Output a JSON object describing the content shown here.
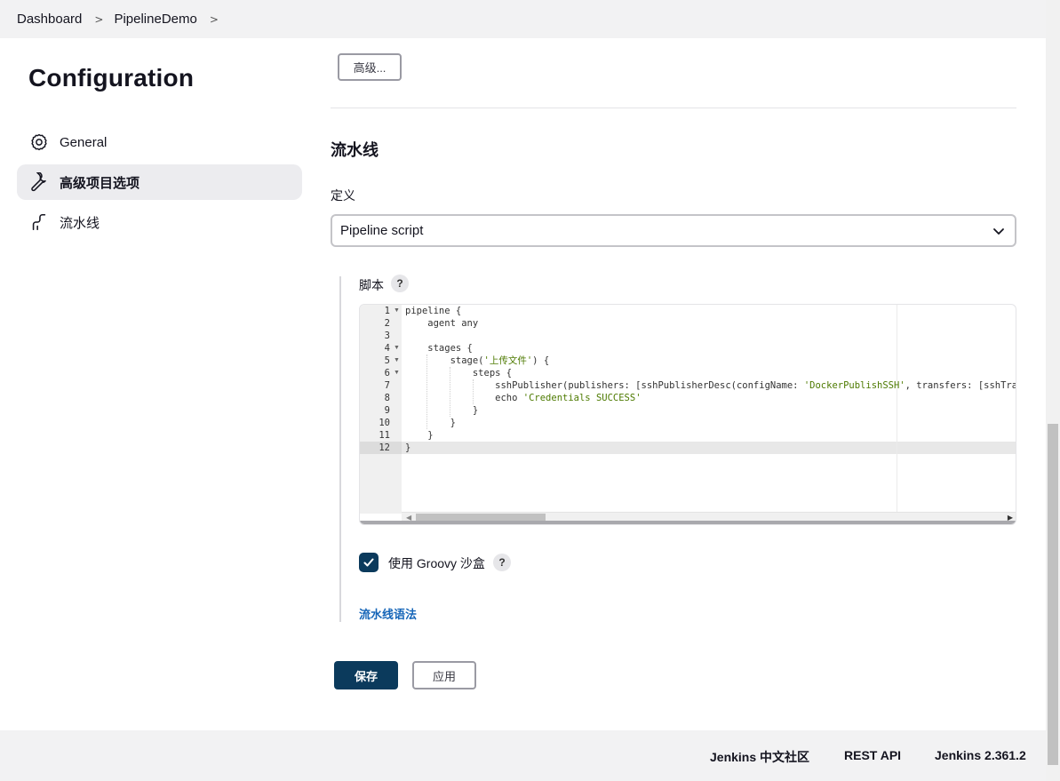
{
  "breadcrumb": {
    "items": [
      "Dashboard",
      "PipelineDemo"
    ],
    "separator": ">"
  },
  "sidebar": {
    "title": "Configuration",
    "items": [
      {
        "label": "General",
        "icon": "gear-icon"
      },
      {
        "label": "高级项目选项",
        "icon": "wrench-icon",
        "active": true
      },
      {
        "label": "流水线",
        "icon": "pipeline-icon"
      }
    ]
  },
  "main": {
    "advanced_button": "高级...",
    "section_title": "流水线",
    "definition_label": "定义",
    "definition_value": "Pipeline script",
    "script_label": "脚本",
    "help_label": "?",
    "code_lines": [
      {
        "num": "1",
        "text": "pipeline {"
      },
      {
        "num": "2",
        "text": "    agent any"
      },
      {
        "num": "3",
        "text": ""
      },
      {
        "num": "4",
        "text": "    stages {"
      },
      {
        "num": "5",
        "pre": "        stage(",
        "str": "'上传文件'",
        "post": ") {"
      },
      {
        "num": "6",
        "text": "            steps {"
      },
      {
        "num": "7",
        "pre": "                sshPublisher(publishers: [sshPublisherDesc(configName: ",
        "str": "'DockerPublishSSH'",
        "post": ", transfers: [sshTra"
      },
      {
        "num": "8",
        "pre": "                echo ",
        "str": "'Credentials SUCCESS'",
        "post": ""
      },
      {
        "num": "9",
        "text": "            }"
      },
      {
        "num": "10",
        "text": "        }"
      },
      {
        "num": "11",
        "text": "    }"
      },
      {
        "num": "12",
        "text": "}"
      }
    ],
    "groovy_sandbox_label": "使用 Groovy 沙盒",
    "groovy_sandbox_checked": true,
    "pipeline_syntax_link": "流水线语法",
    "save_button": "保存",
    "apply_button": "应用"
  },
  "footer": {
    "community": "Jenkins 中文社区",
    "rest_api": "REST API",
    "version": "Jenkins 2.361.2"
  },
  "colors": {
    "primary": "#0b3a5c",
    "link": "#1565b8",
    "string": "#4d7a00"
  }
}
